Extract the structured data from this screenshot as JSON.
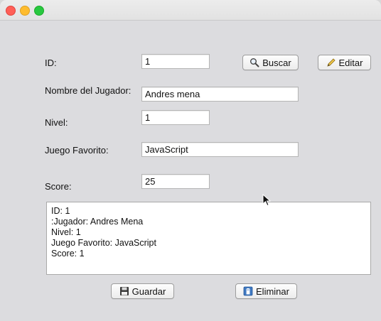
{
  "window": {
    "traffic_lights": [
      "close",
      "minimize",
      "zoom"
    ]
  },
  "form": {
    "id_label": "ID:",
    "id_value": "1",
    "nombre_label": "Nombre del Jugador:",
    "nombre_value": "Andres mena",
    "nivel_label": "Nivel:",
    "nivel_value": "1",
    "juego_label": "Juego Favorito:",
    "juego_value": "JavaScript",
    "score_label": "Score:",
    "score_value": "25"
  },
  "buttons": {
    "buscar": "Buscar",
    "editar": "Editar",
    "guardar": "Guardar",
    "eliminar": "Eliminar"
  },
  "output": {
    "lines": [
      "ID: 1",
      ":Jugador: Andres Mena",
      "Nivel: 1",
      "Juego Favorito: JavaScript",
      "Score: 1"
    ]
  },
  "icons": {
    "buscar": "magnifier-icon",
    "editar": "pencil-icon",
    "guardar": "floppy-disk-icon",
    "eliminar": "trash-icon"
  }
}
